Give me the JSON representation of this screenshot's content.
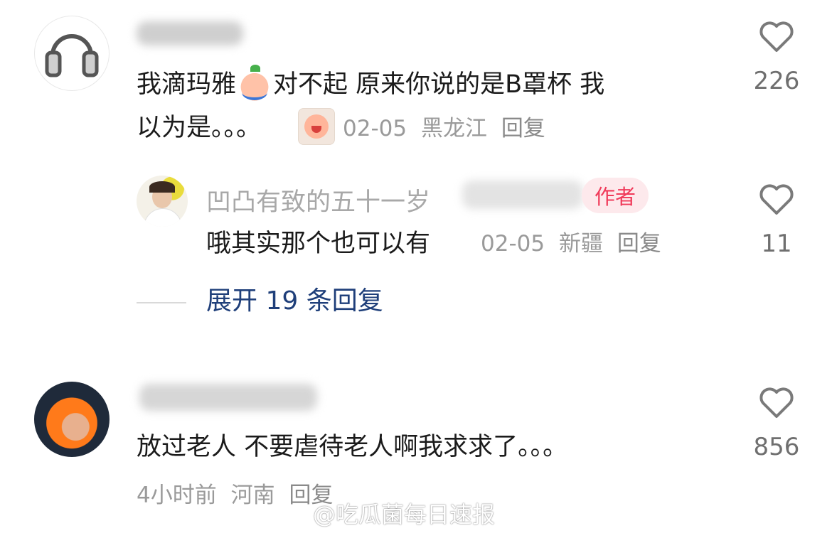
{
  "comments": [
    {
      "username": "",
      "text_line1": "我滴玛雅",
      "text_line1b": "对不起 原来你说的是B罩杯 我",
      "text_line2": "以为是。。。",
      "date": "02-05",
      "location": "黑龙江",
      "reply_label": "回复",
      "likes": "226",
      "avatar_icon": "headphones-icon"
    },
    {
      "username": "凹凸有致的五十一岁",
      "badge": "作者",
      "text": "哦其实那个也可以有",
      "date": "02-05",
      "location": "新疆",
      "reply_label": "回复",
      "likes": "11"
    },
    {
      "username": "",
      "text": "放过老人 不要虐待老人啊我求求了。。。",
      "time": "4小时前",
      "location": "河南",
      "reply_label": "回复",
      "likes": "856"
    }
  ],
  "expand_replies": "展开 19 条回复",
  "watermark": "@吃瓜菌每日速报",
  "colors": {
    "like_heart": "#7a7a7a",
    "link_blue": "#1f3f7a",
    "author_badge_bg": "#fde9ec",
    "author_badge_text": "#f03a5a"
  }
}
